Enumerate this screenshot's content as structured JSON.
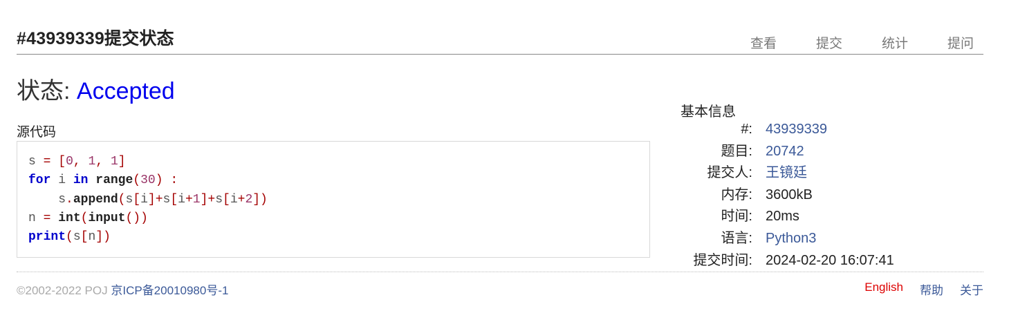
{
  "header": {
    "title": "#43939339提交状态",
    "nav": [
      "查看",
      "提交",
      "统计",
      "提问"
    ]
  },
  "status": {
    "label": "状态:",
    "value": "Accepted",
    "value_color": "#0000ee"
  },
  "source": {
    "label": "源代码",
    "lines": [
      "s = [0, 1, 1]",
      "for i in range(30) :",
      "    s.append(s[i]+s[i+1]+s[i+2])",
      "n = int(input())",
      "print(s[n])"
    ]
  },
  "info": {
    "title": "基本信息",
    "rows": [
      {
        "key": "#:",
        "value": "43939339",
        "link": true
      },
      {
        "key": "题目:",
        "value": "20742",
        "link": true
      },
      {
        "key": "提交人:",
        "value": "王镜廷",
        "link": true
      },
      {
        "key": "内存:",
        "value": "3600kB",
        "link": false
      },
      {
        "key": "时间:",
        "value": "20ms",
        "link": false
      },
      {
        "key": "语言:",
        "value": "Python3",
        "link": true
      },
      {
        "key": "提交时间:",
        "value": "2024-02-20 16:07:41",
        "link": false
      }
    ]
  },
  "footer": {
    "copyright": "©2002-2022 POJ",
    "icp": "京ICP备20010980号-1",
    "links": [
      "English",
      "帮助",
      "关于"
    ]
  },
  "colors": {
    "link": "#3b5998",
    "accepted": "#0000ee",
    "english_link": "#dd0000"
  }
}
